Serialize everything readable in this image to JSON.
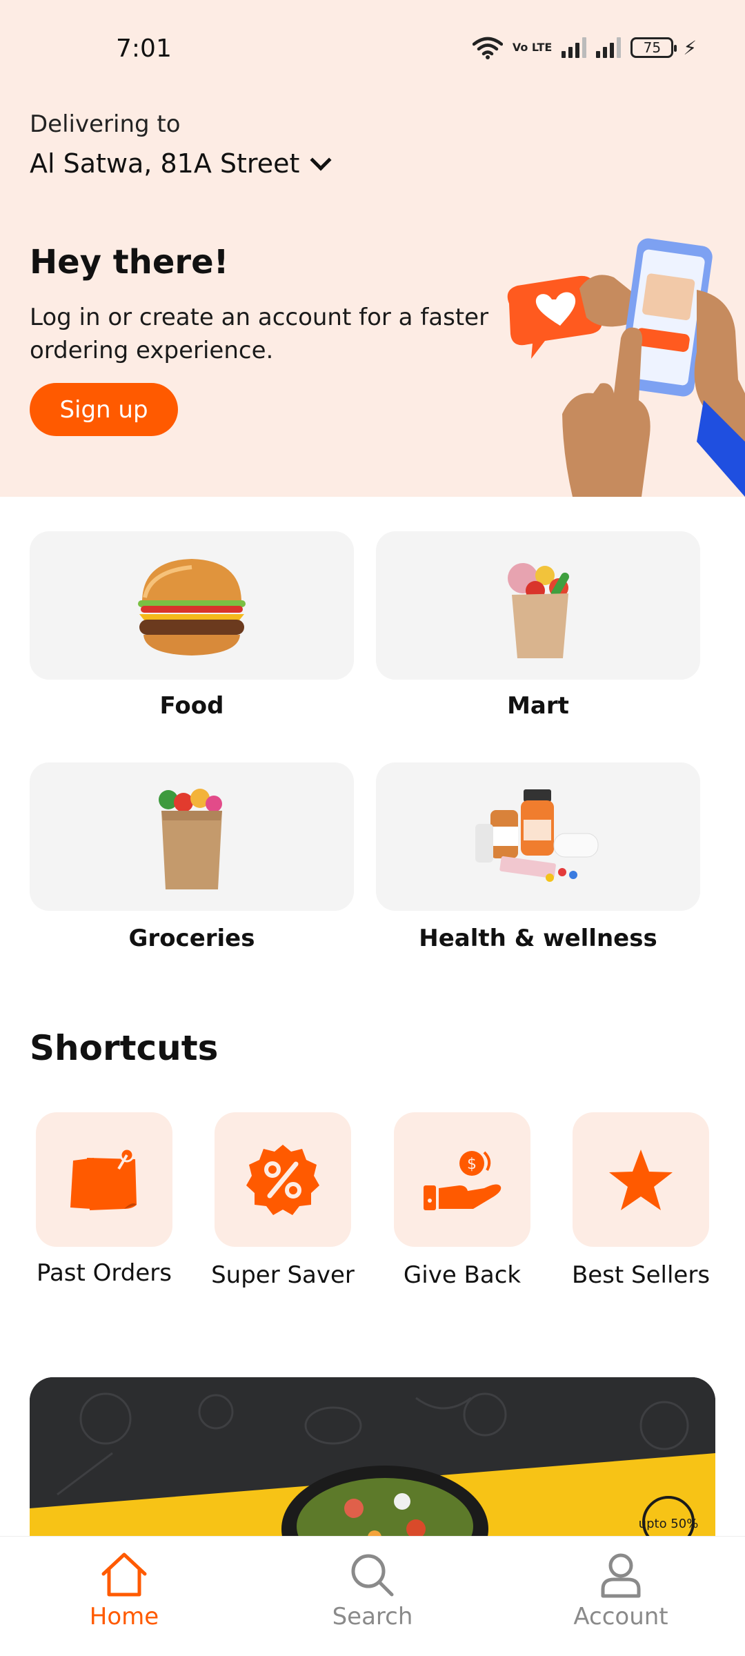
{
  "status_bar": {
    "time": "7:01",
    "volte": "Vo LTE",
    "battery": "75"
  },
  "delivery": {
    "label": "Delivering to",
    "address": "Al Satwa, 81A Street"
  },
  "hero": {
    "title": "Hey there!",
    "subtitle": "Log in or create an account for a faster ordering experience.",
    "signup_label": "Sign up"
  },
  "categories": [
    {
      "label": "Food",
      "icon": "burger-icon"
    },
    {
      "label": "Mart",
      "icon": "mart-bag-icon"
    },
    {
      "label": "Groceries",
      "icon": "grocery-bag-icon"
    },
    {
      "label": "Health & wellness",
      "icon": "pharmacy-icon"
    }
  ],
  "shortcuts": {
    "title": "Shortcuts",
    "items": [
      {
        "label": "Past Orders",
        "icon": "notes-icon"
      },
      {
        "label": "Super Saver",
        "icon": "discount-badge-icon"
      },
      {
        "label": "Give Back",
        "icon": "donate-hand-icon"
      },
      {
        "label": "Best Sellers",
        "icon": "star-icon"
      }
    ]
  },
  "banner": {
    "badge_text": "upto 50%"
  },
  "bottom_nav": [
    {
      "label": "Home",
      "active": true
    },
    {
      "label": "Search",
      "active": false
    },
    {
      "label": "Account",
      "active": false
    }
  ],
  "colors": {
    "accent": "#ff5a00",
    "header_bg": "#fdece4",
    "tile_bg": "#f4f4f4",
    "inactive": "#8a8a8a"
  }
}
